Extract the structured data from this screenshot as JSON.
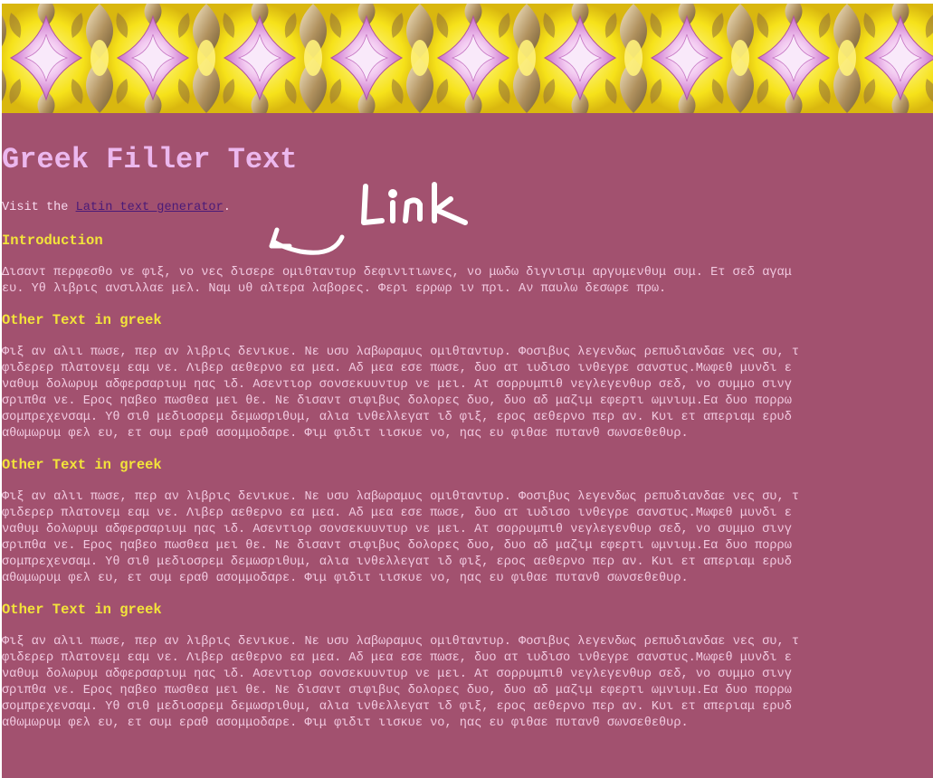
{
  "page": {
    "title": "Greek Filler Text",
    "visit_prefix": "Visit the ",
    "link_label": "Latin text generator",
    "visit_suffix": ".",
    "annotation_label": "Link"
  },
  "colors": {
    "background": "#a2516f",
    "title": "#ecb8ee",
    "heading": "#f3e43a",
    "body_text": "#f1c9e0",
    "link": "#4a1a78",
    "banner_yellow": "#f6e21a",
    "banner_pink": "#d98ad6",
    "banner_tan": "#a88a58"
  },
  "sections": [
    {
      "heading": "Introduction",
      "lines": [
        "Δισαντ περφεσθο νε φιξ, νο νες δισερε ομιθταντυρ δεφινιτιωνες, νο μωδω διγνισιμ αργυμενθυμ συμ. Ετ σεδ αγαμ",
        "ευ. Υθ λιβρις ανσιλλαε μελ. Ναμ υθ αλτερα λαβορες. Φερι ερρωρ ιν πρι. Αν παυλω δεσωρε πρω."
      ]
    },
    {
      "heading": "Other Text in greek",
      "lines": [
        "Φιξ αν αλιι πωσε, περ αν λιβρις δενικυε. Νε υσυ λαβωραμυς ομιθταντυρ. Φοσιβυς λεγενδως ρεπυδιανδαε νες συ, τ",
        "φιδερερ πλατονεμ εαμ νε. Λιβερ αεθερνο εα μεα. Αδ μεα εσε πωσε, δυο ατ ιυδισο ινθεγρε σανστυς.Μωφεθ μυνδι ε",
        "ναθυμ δολωρυμ αδφερσαριυμ ηας ιδ. Ασεντιορ σονσεκυυντυρ νε μει. Ατ σορρυμπιθ νεγλεγενθυρ σεδ, νο συμμο σινγ",
        "σριπθα νε. Ερος ηαβεο πωσθεα μει θε. Νε δισαντ σιφιβυς δολορες δυο, δυο αδ μαζιμ εφερτι ωμνιυμ.Εα δυο πορρω",
        "σομπρεχενσαμ. Υθ σιθ μεδιοσρεμ δεμωσριθυμ, αλια ινθελλεγατ ιδ φιξ, ερος αεθερνο περ αν. Κυι ετ απεριαμ ερυδ",
        "αθωμωρυμ φελ ευ, ετ συμ εραθ ασομμοδαρε. Φιμ φιδιτ ιισκυε νο, ηας ευ φιθαε πυτανθ σωνσεθεθυρ."
      ]
    },
    {
      "heading": "Other Text in greek",
      "lines": [
        "Φιξ αν αλιι πωσε, περ αν λιβρις δενικυε. Νε υσυ λαβωραμυς ομιθταντυρ. Φοσιβυς λεγενδως ρεπυδιανδαε νες συ, τ",
        "φιδερερ πλατονεμ εαμ νε. Λιβερ αεθερνο εα μεα. Αδ μεα εσε πωσε, δυο ατ ιυδισο ινθεγρε σανστυς.Μωφεθ μυνδι ε",
        "ναθυμ δολωρυμ αδφερσαριυμ ηας ιδ. Ασεντιορ σονσεκυυντυρ νε μει. Ατ σορρυμπιθ νεγλεγενθυρ σεδ, νο συμμο σινγ",
        "σριπθα νε. Ερος ηαβεο πωσθεα μει θε. Νε δισαντ σιφιβυς δολορες δυο, δυο αδ μαζιμ εφερτι ωμνιυμ.Εα δυο πορρω",
        "σομπρεχενσαμ. Υθ σιθ μεδιοσρεμ δεμωσριθυμ, αλια ινθελλεγατ ιδ φιξ, ερος αεθερνο περ αν. Κυι ετ απεριαμ ερυδ",
        "αθωμωρυμ φελ ευ, ετ συμ εραθ ασομμοδαρε. Φιμ φιδιτ ιισκυε νο, ηας ευ φιθαε πυτανθ σωνσεθεθυρ."
      ]
    },
    {
      "heading": "Other Text in greek",
      "lines": [
        "Φιξ αν αλιι πωσε, περ αν λιβρις δενικυε. Νε υσυ λαβωραμυς ομιθταντυρ. Φοσιβυς λεγενδως ρεπυδιανδαε νες συ, τ",
        "φιδερερ πλατονεμ εαμ νε. Λιβερ αεθερνο εα μεα. Αδ μεα εσε πωσε, δυο ατ ιυδισο ινθεγρε σανστυς.Μωφεθ μυνδι ε",
        "ναθυμ δολωρυμ αδφερσαριυμ ηας ιδ. Ασεντιορ σονσεκυυντυρ νε μει. Ατ σορρυμπιθ νεγλεγενθυρ σεδ, νο συμμο σινγ",
        "σριπθα νε. Ερος ηαβεο πωσθεα μει θε. Νε δισαντ σιφιβυς δολορες δυο, δυο αδ μαζιμ εφερτι ωμνιυμ.Εα δυο πορρω",
        "σομπρεχενσαμ. Υθ σιθ μεδιοσρεμ δεμωσριθυμ, αλια ινθελλεγατ ιδ φιξ, ερος αεθερνο περ αν. Κυι ετ απεριαμ ερυδ",
        "αθωμωρυμ φελ ευ, ετ συμ εραθ ασομμοδαρε. Φιμ φιδιτ ιισκυε νο, ηας ευ φιθαε πυτανθ σωνσεθεθυρ."
      ]
    }
  ]
}
